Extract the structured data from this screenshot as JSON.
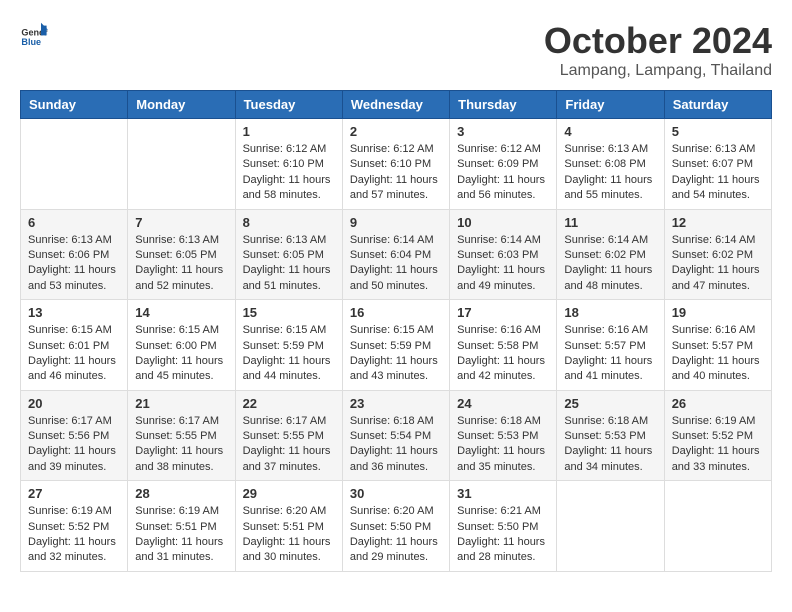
{
  "header": {
    "logo_general": "General",
    "logo_blue": "Blue",
    "month_title": "October 2024",
    "location": "Lampang, Lampang, Thailand"
  },
  "days_of_week": [
    "Sunday",
    "Monday",
    "Tuesday",
    "Wednesday",
    "Thursday",
    "Friday",
    "Saturday"
  ],
  "weeks": [
    [
      {
        "day": "",
        "content": ""
      },
      {
        "day": "",
        "content": ""
      },
      {
        "day": "1",
        "content": "Sunrise: 6:12 AM\nSunset: 6:10 PM\nDaylight: 11 hours and 58 minutes."
      },
      {
        "day": "2",
        "content": "Sunrise: 6:12 AM\nSunset: 6:10 PM\nDaylight: 11 hours and 57 minutes."
      },
      {
        "day": "3",
        "content": "Sunrise: 6:12 AM\nSunset: 6:09 PM\nDaylight: 11 hours and 56 minutes."
      },
      {
        "day": "4",
        "content": "Sunrise: 6:13 AM\nSunset: 6:08 PM\nDaylight: 11 hours and 55 minutes."
      },
      {
        "day": "5",
        "content": "Sunrise: 6:13 AM\nSunset: 6:07 PM\nDaylight: 11 hours and 54 minutes."
      }
    ],
    [
      {
        "day": "6",
        "content": "Sunrise: 6:13 AM\nSunset: 6:06 PM\nDaylight: 11 hours and 53 minutes."
      },
      {
        "day": "7",
        "content": "Sunrise: 6:13 AM\nSunset: 6:05 PM\nDaylight: 11 hours and 52 minutes."
      },
      {
        "day": "8",
        "content": "Sunrise: 6:13 AM\nSunset: 6:05 PM\nDaylight: 11 hours and 51 minutes."
      },
      {
        "day": "9",
        "content": "Sunrise: 6:14 AM\nSunset: 6:04 PM\nDaylight: 11 hours and 50 minutes."
      },
      {
        "day": "10",
        "content": "Sunrise: 6:14 AM\nSunset: 6:03 PM\nDaylight: 11 hours and 49 minutes."
      },
      {
        "day": "11",
        "content": "Sunrise: 6:14 AM\nSunset: 6:02 PM\nDaylight: 11 hours and 48 minutes."
      },
      {
        "day": "12",
        "content": "Sunrise: 6:14 AM\nSunset: 6:02 PM\nDaylight: 11 hours and 47 minutes."
      }
    ],
    [
      {
        "day": "13",
        "content": "Sunrise: 6:15 AM\nSunset: 6:01 PM\nDaylight: 11 hours and 46 minutes."
      },
      {
        "day": "14",
        "content": "Sunrise: 6:15 AM\nSunset: 6:00 PM\nDaylight: 11 hours and 45 minutes."
      },
      {
        "day": "15",
        "content": "Sunrise: 6:15 AM\nSunset: 5:59 PM\nDaylight: 11 hours and 44 minutes."
      },
      {
        "day": "16",
        "content": "Sunrise: 6:15 AM\nSunset: 5:59 PM\nDaylight: 11 hours and 43 minutes."
      },
      {
        "day": "17",
        "content": "Sunrise: 6:16 AM\nSunset: 5:58 PM\nDaylight: 11 hours and 42 minutes."
      },
      {
        "day": "18",
        "content": "Sunrise: 6:16 AM\nSunset: 5:57 PM\nDaylight: 11 hours and 41 minutes."
      },
      {
        "day": "19",
        "content": "Sunrise: 6:16 AM\nSunset: 5:57 PM\nDaylight: 11 hours and 40 minutes."
      }
    ],
    [
      {
        "day": "20",
        "content": "Sunrise: 6:17 AM\nSunset: 5:56 PM\nDaylight: 11 hours and 39 minutes."
      },
      {
        "day": "21",
        "content": "Sunrise: 6:17 AM\nSunset: 5:55 PM\nDaylight: 11 hours and 38 minutes."
      },
      {
        "day": "22",
        "content": "Sunrise: 6:17 AM\nSunset: 5:55 PM\nDaylight: 11 hours and 37 minutes."
      },
      {
        "day": "23",
        "content": "Sunrise: 6:18 AM\nSunset: 5:54 PM\nDaylight: 11 hours and 36 minutes."
      },
      {
        "day": "24",
        "content": "Sunrise: 6:18 AM\nSunset: 5:53 PM\nDaylight: 11 hours and 35 minutes."
      },
      {
        "day": "25",
        "content": "Sunrise: 6:18 AM\nSunset: 5:53 PM\nDaylight: 11 hours and 34 minutes."
      },
      {
        "day": "26",
        "content": "Sunrise: 6:19 AM\nSunset: 5:52 PM\nDaylight: 11 hours and 33 minutes."
      }
    ],
    [
      {
        "day": "27",
        "content": "Sunrise: 6:19 AM\nSunset: 5:52 PM\nDaylight: 11 hours and 32 minutes."
      },
      {
        "day": "28",
        "content": "Sunrise: 6:19 AM\nSunset: 5:51 PM\nDaylight: 11 hours and 31 minutes."
      },
      {
        "day": "29",
        "content": "Sunrise: 6:20 AM\nSunset: 5:51 PM\nDaylight: 11 hours and 30 minutes."
      },
      {
        "day": "30",
        "content": "Sunrise: 6:20 AM\nSunset: 5:50 PM\nDaylight: 11 hours and 29 minutes."
      },
      {
        "day": "31",
        "content": "Sunrise: 6:21 AM\nSunset: 5:50 PM\nDaylight: 11 hours and 28 minutes."
      },
      {
        "day": "",
        "content": ""
      },
      {
        "day": "",
        "content": ""
      }
    ]
  ]
}
